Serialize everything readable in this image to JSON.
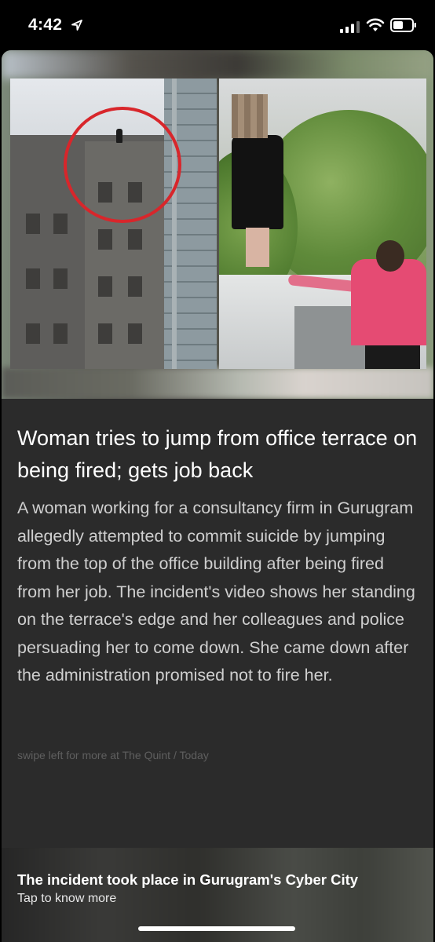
{
  "status_bar": {
    "time": "4:42",
    "icons": [
      "location-arrow-icon",
      "signal-icon",
      "wifi-icon",
      "battery-icon"
    ]
  },
  "article": {
    "headline": "Woman tries to jump from office terrace on being fired; gets job back",
    "body": "A woman working for a consultancy firm in Gurugram allegedly attempted to commit suicide by jumping from the top of the office building after being fired from her job. The incident's video shows her standing on the terrace's edge and her colleagues and police persuading her to come down. She came down after the administration promised not to fire her.",
    "source_prefix": "swipe left for more at ",
    "source_name": "The Quint",
    "source_sep": " / ",
    "source_time": "Today"
  },
  "bottom_bar": {
    "title": "The incident took place in Gurugram's Cyber City",
    "subtitle": "Tap to know more"
  },
  "colors": {
    "card_bg": "#2b2b2b",
    "circle_highlight": "#d8262b"
  }
}
